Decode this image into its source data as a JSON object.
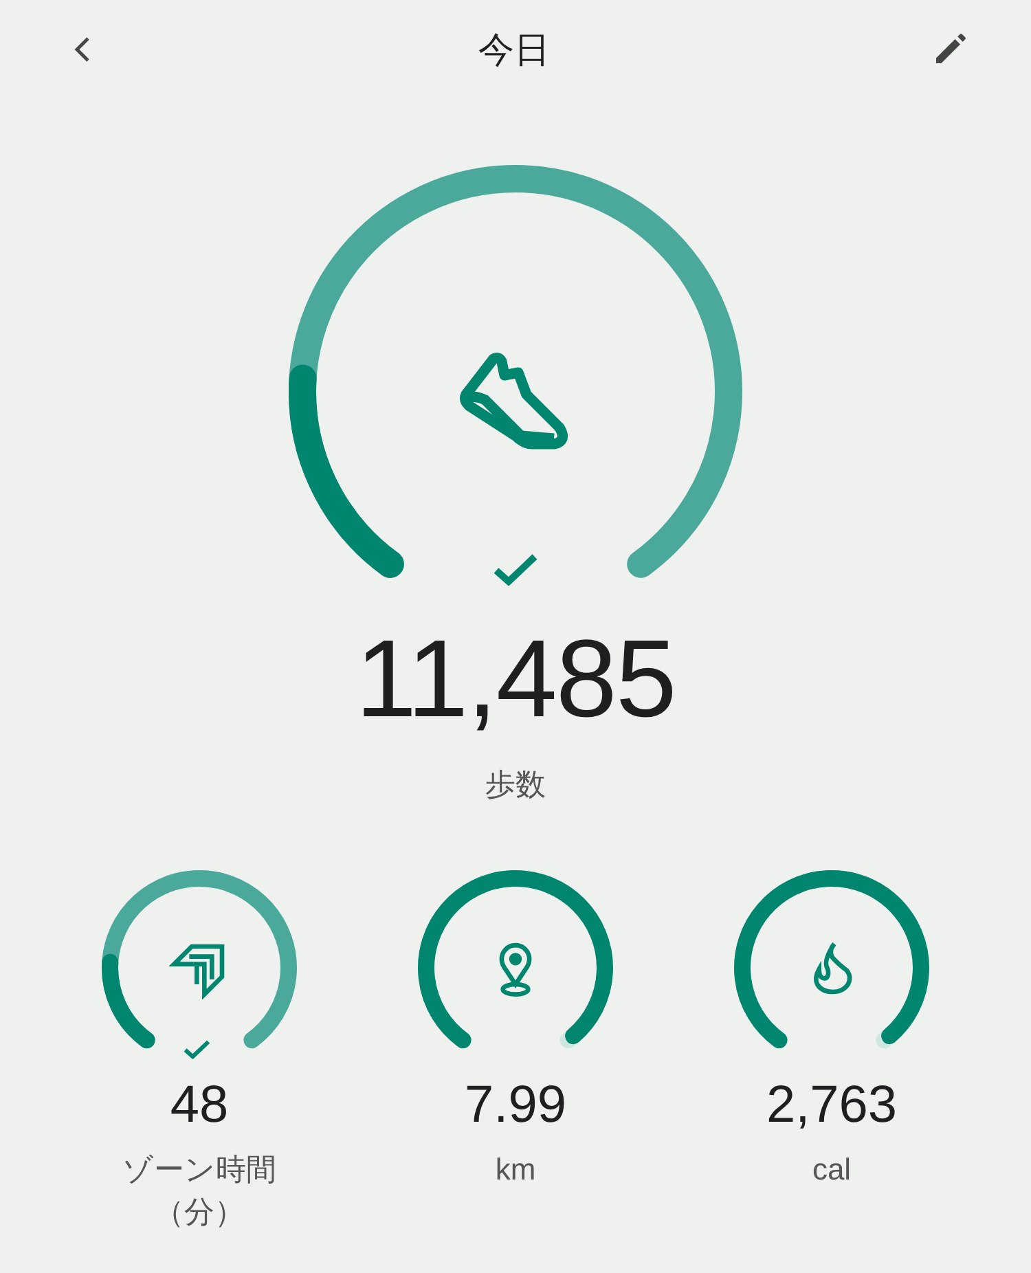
{
  "header": {
    "title": "今日"
  },
  "main": {
    "kind": "steps",
    "value": "11,485",
    "label": "歩数",
    "goal_met": true
  },
  "stats": [
    {
      "kind": "zone",
      "value": "48",
      "label": "ゾーン時間（分）",
      "goal_met": true
    },
    {
      "kind": "distance",
      "value": "7.99",
      "label": "km",
      "goal_met": false
    },
    {
      "kind": "calories",
      "value": "2,763",
      "label": "cal",
      "goal_met": false
    }
  ]
}
